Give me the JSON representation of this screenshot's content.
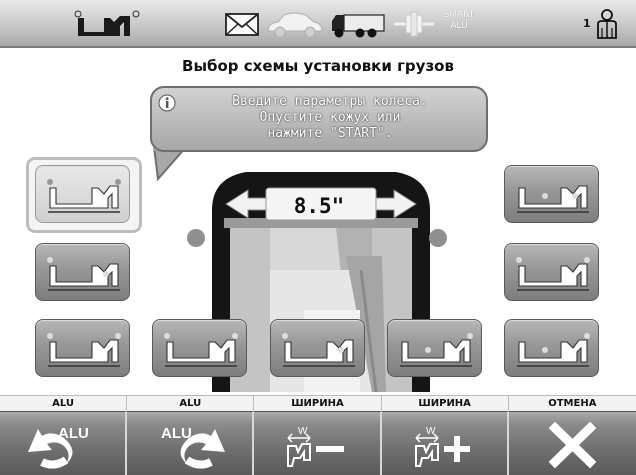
{
  "topbar": {
    "smart_label": "SMART\nALU",
    "operator_number": "1",
    "icons": [
      "wheel-profile-icon",
      "mail-icon",
      "car-icon",
      "truck-icon",
      "weight-icon",
      "operator-icon"
    ]
  },
  "title": "Выбор схемы установки грузов",
  "bubble": {
    "text": "Введите параметры колеса.\nОпустите кожух или\nнажмите \"START\"."
  },
  "wheel": {
    "width_value": "8.5\""
  },
  "schemes": [
    {
      "name": "scheme-1",
      "selected": true
    },
    {
      "name": "scheme-2",
      "selected": false
    },
    {
      "name": "scheme-3",
      "selected": false
    },
    {
      "name": "scheme-4",
      "selected": false
    },
    {
      "name": "scheme-5",
      "selected": false
    },
    {
      "name": "scheme-6",
      "selected": false
    },
    {
      "name": "scheme-7",
      "selected": false
    },
    {
      "name": "scheme-8",
      "selected": false
    },
    {
      "name": "scheme-9",
      "selected": false
    }
  ],
  "function_keys": {
    "labels": [
      "ALU",
      "ALU",
      "ШИРИНА",
      "ШИРИНА",
      "ОТМЕНА"
    ],
    "alu_icon_text": "ALU",
    "width_icon_text": "W"
  },
  "colors": {
    "button_gray": "#8a8a8a",
    "accent_white": "#ffffff",
    "text_dark": "#111111"
  }
}
